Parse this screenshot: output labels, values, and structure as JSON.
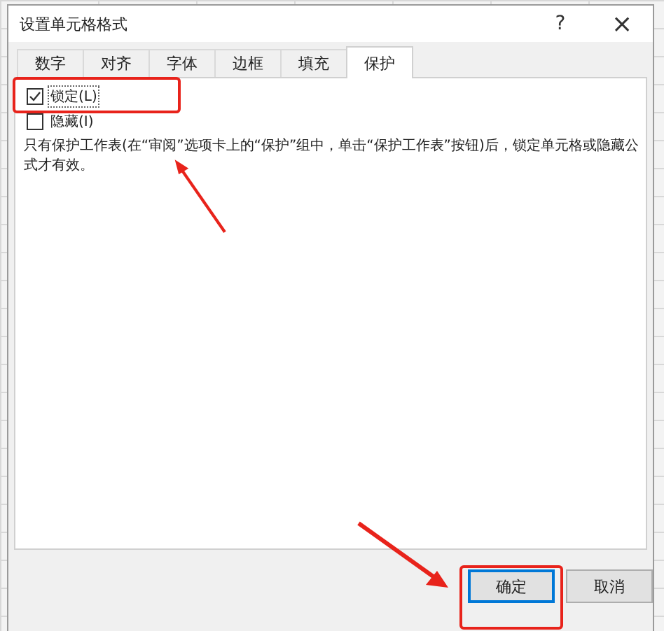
{
  "dialog": {
    "title": "设置单元格格式",
    "help": "?",
    "close": "×"
  },
  "tabs": [
    {
      "label": "数字",
      "selected": false
    },
    {
      "label": "对齐",
      "selected": false
    },
    {
      "label": "字体",
      "selected": false
    },
    {
      "label": "边框",
      "selected": false
    },
    {
      "label": "填充",
      "selected": false
    },
    {
      "label": "保护",
      "selected": true
    }
  ],
  "options": [
    {
      "label": "锁定(L)",
      "checked": true
    },
    {
      "label": "隐藏(I)",
      "checked": false
    }
  ],
  "note": "只有保护工作表(在“审阅”选项卡上的“保护”组中，单击“保护工作表”按钮)后，锁定单元格或隐藏公式才有效。",
  "buttons": [
    {
      "label": "确定",
      "default": true
    },
    {
      "label": "取消",
      "default": false
    }
  ]
}
